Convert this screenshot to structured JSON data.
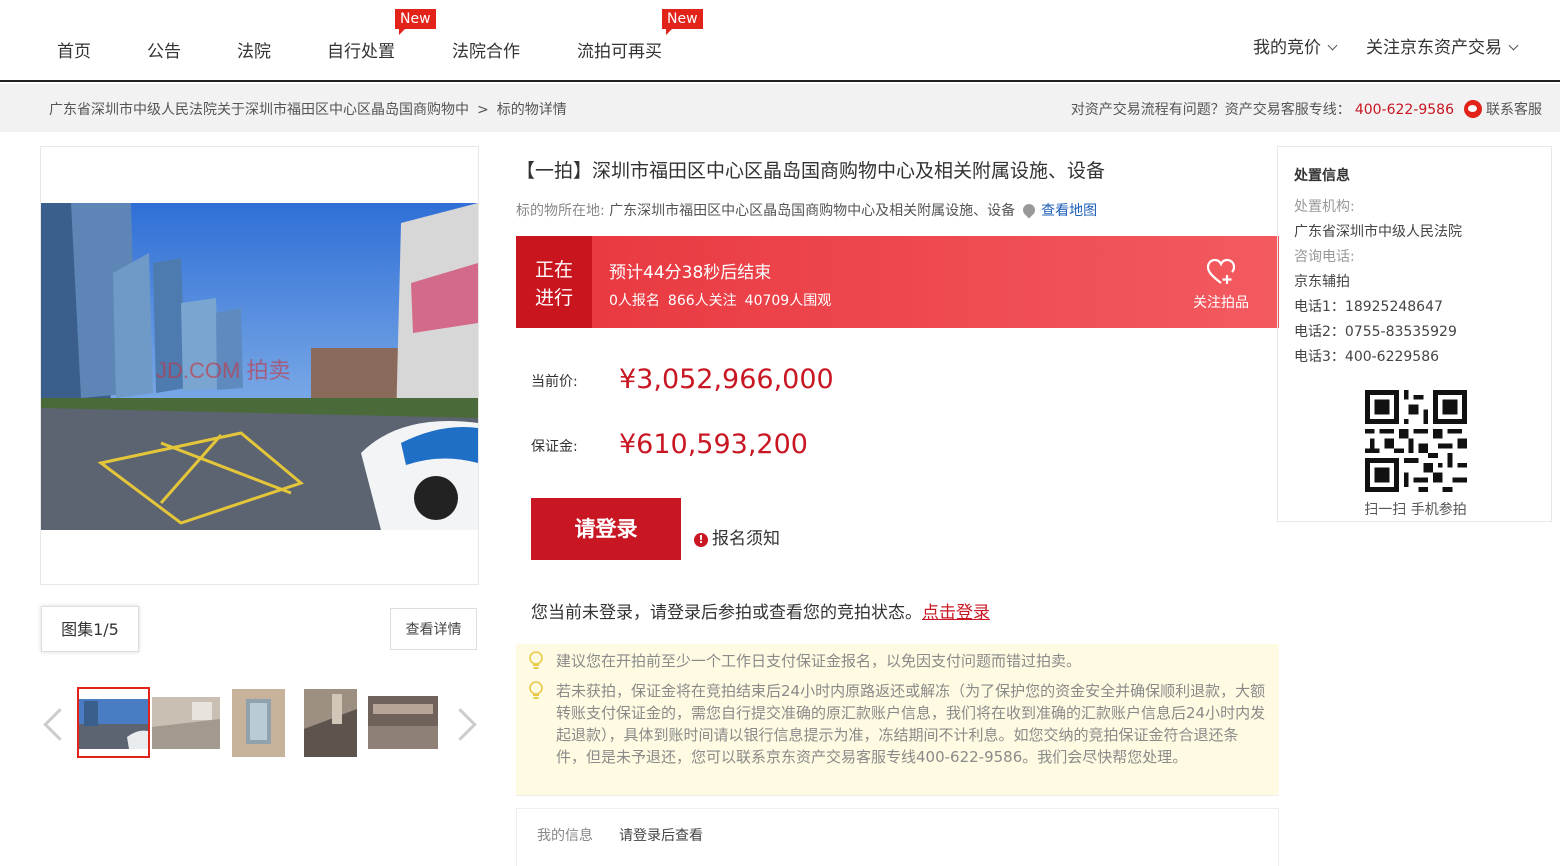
{
  "nav": {
    "items": [
      "首页",
      "公告",
      "法院",
      "自行处置",
      "法院合作",
      "流拍可再买"
    ],
    "new_badge": "New",
    "my_bid": "我的竞价",
    "follow_jd": "关注京东资产交易"
  },
  "breadcrumb": {
    "parent": "广东省深圳市中级人民法院关于深圳市福田区中心区晶岛国商购物中",
    "separator": ">",
    "current": "标的物详情"
  },
  "service": {
    "question": "对资产交易流程有问题？资产交易客服专线：",
    "phone": "400-622-9586",
    "contact": "联系客服"
  },
  "gallery": {
    "album_label": "图集1/5",
    "detail_button": "查看详情",
    "watermark": "JD.COM 拍卖"
  },
  "item": {
    "title": "【一拍】深圳市福田区中心区晶岛国商购物中心及相关附属设施、设备",
    "location_label": "标的物所在地:",
    "location_value": "广东深圳市福田区中心区晶岛国商购物中心及相关附属设施、设备",
    "map_link": "查看地图"
  },
  "status": {
    "tag_line1": "正在",
    "tag_line2": "进行",
    "countdown": "预计44分38秒后结束",
    "signup": "0人报名",
    "followers": "866人关注",
    "viewers": "40709人围观",
    "follow_label": "关注拍品"
  },
  "price": {
    "current_label": "当前价:",
    "current_value": "¥3,052,966,000",
    "deposit_label": "保证金:",
    "deposit_value": "¥610,593,200"
  },
  "actions": {
    "login_button": "请登录",
    "notice": "报名须知",
    "login_tip": "您当前未登录，请登录后参拍或查看您的竞拍状态。",
    "login_link": "点击登录"
  },
  "tips": {
    "tip1": "建议您在开拍前至少一个工作日支付保证金报名，以免因支付问题而错过拍卖。",
    "tip2": "若未获拍，保证金将在竞拍结束后24小时内原路返还或解冻（为了保护您的资金安全并确保顺利退款，大额转账支付保证金的，需您自行提交准确的原汇款账户信息，我们将在收到准确的汇款账户信息后24小时内发起退款），具体到账时间请以银行信息提示为准，冻结期间不计利息。如您交纳的竞拍保证金符合退还条件，但是未予退还，您可以联系京东资产交易客服专线400-622-9586。我们会尽快帮您处理。"
  },
  "my_info": {
    "label": "我的信息",
    "value": "请登录后查看"
  },
  "disposal": {
    "title": "处置信息",
    "org_label": "处置机构:",
    "org_value": "广东省深圳市中级人民法院",
    "consult_label": "咨询电话:",
    "consult_value": "京东辅拍",
    "phone1": "电话1：18925248647",
    "phone2": "电话2：0755-83535929",
    "phone3": "电话3：400-6229586",
    "qr_caption": "扫一扫 手机参拍"
  }
}
